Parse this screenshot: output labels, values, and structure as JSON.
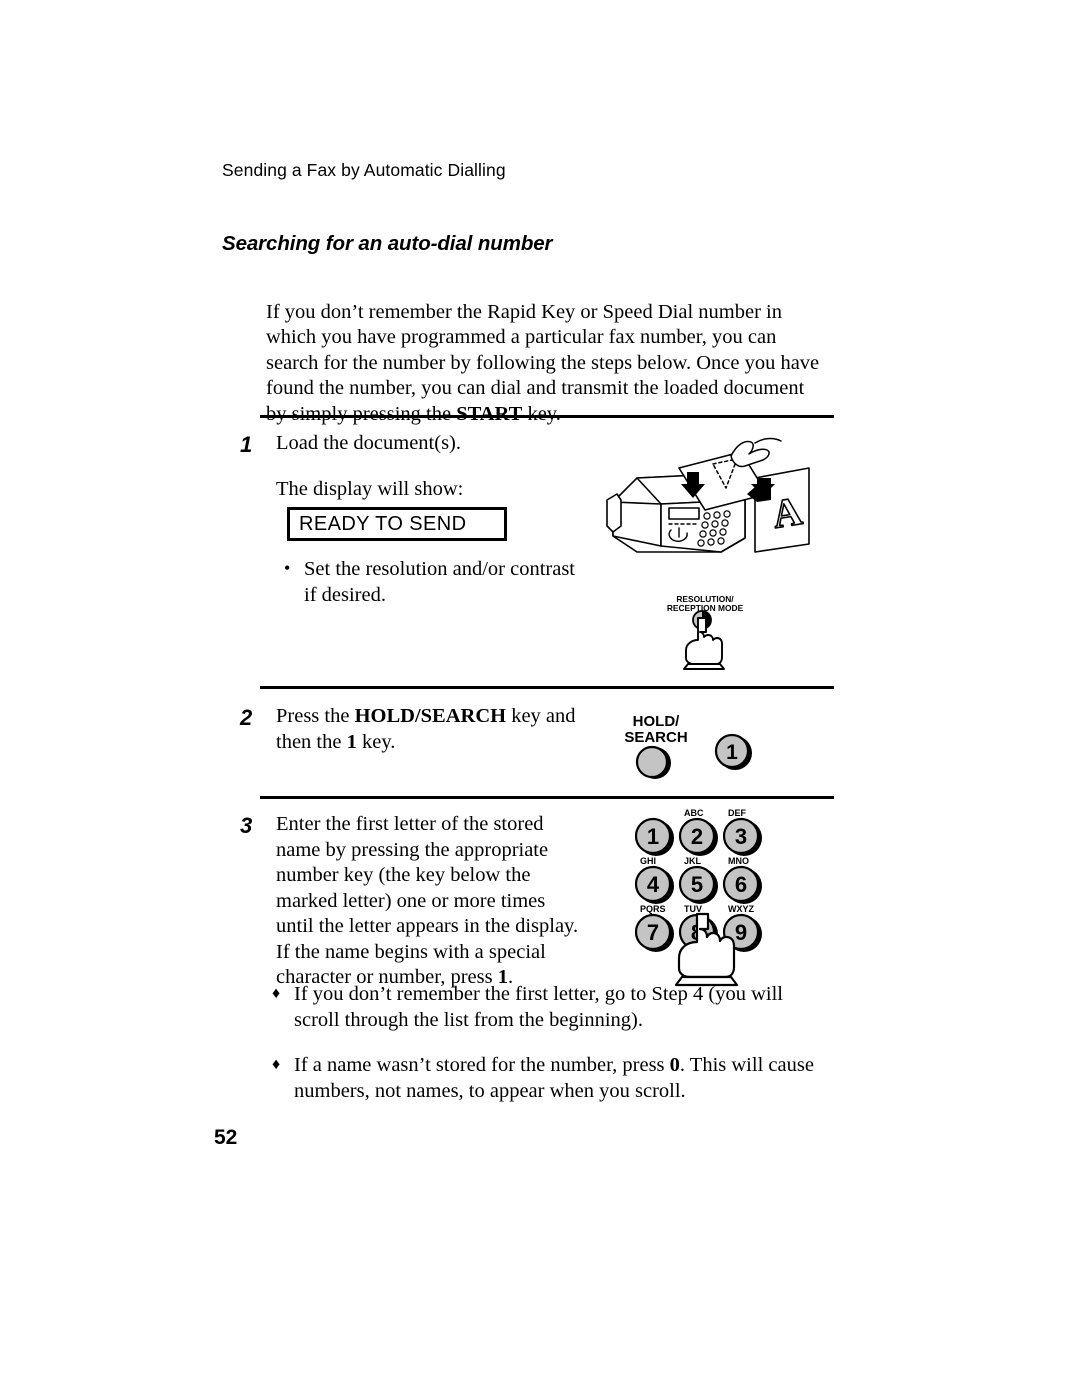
{
  "header": {
    "running_head": "Sending a Fax by Automatic Dialling"
  },
  "section": {
    "title": "Searching for an auto-dial number"
  },
  "intro": {
    "before_bold": "If you don’t remember the Rapid Key or Speed Dial number in which you have programmed a particular fax number, you can search for the number by following the steps below. Once you have found the number, you can dial and transmit the loaded document by simply pressing the ",
    "bold": "START",
    "after_bold": " key."
  },
  "steps": [
    {
      "number": "1",
      "line1": "Load the document(s).",
      "line2": "The display will show:",
      "display_value": "READY TO SEND",
      "bullets": [
        "Set the resolution and/or contrast if desired."
      ]
    },
    {
      "number": "2",
      "text_before_bold": "Press the ",
      "bold_1": "HOLD/SEARCH",
      "text_mid": " key and then the ",
      "bold_2": "1",
      "text_after": " key."
    },
    {
      "number": "3",
      "text_before_bold": "Enter the first letter of the stored name by pressing the appropriate number key (the key below the marked letter) one or more times until the letter appears in the display. If the name begins with a special character or number, press ",
      "bold": "1",
      "text_after": "."
    }
  ],
  "notes": [
    {
      "text_before_bold": "If you don’t remember the first letter, go to Step 4 (you will scroll through the list from the beginning).",
      "bold": "",
      "text_after": ""
    },
    {
      "text_before_bold": "If a name wasn’t stored for the number, press ",
      "bold": "0",
      "text_after": ". This will cause numbers, not names, to appear when you scroll."
    }
  ],
  "illustrations": {
    "fax_machine": {
      "page_letter": "A"
    },
    "resolution_button": {
      "label_line1": "RESOLUTION/",
      "label_line2": "RECEPTION MODE"
    },
    "hold_search": {
      "label_line1": "HOLD/",
      "label_line2": "SEARCH",
      "key_label": "1"
    },
    "keypad": {
      "keys": [
        {
          "digit": "1",
          "letters": ""
        },
        {
          "digit": "2",
          "letters": "ABC"
        },
        {
          "digit": "3",
          "letters": "DEF"
        },
        {
          "digit": "4",
          "letters": "GHI"
        },
        {
          "digit": "5",
          "letters": "JKL"
        },
        {
          "digit": "6",
          "letters": "MNO"
        },
        {
          "digit": "7",
          "letters": "PQRS"
        },
        {
          "digit": "8",
          "letters": "TUV"
        },
        {
          "digit": "9",
          "letters": "WXYZ"
        }
      ],
      "pressed_key": "8"
    }
  },
  "footer": {
    "page_number": "52"
  },
  "colors": {
    "ink": "#000000",
    "paper": "#ffffff",
    "button_gray": "#c4c4c4"
  }
}
